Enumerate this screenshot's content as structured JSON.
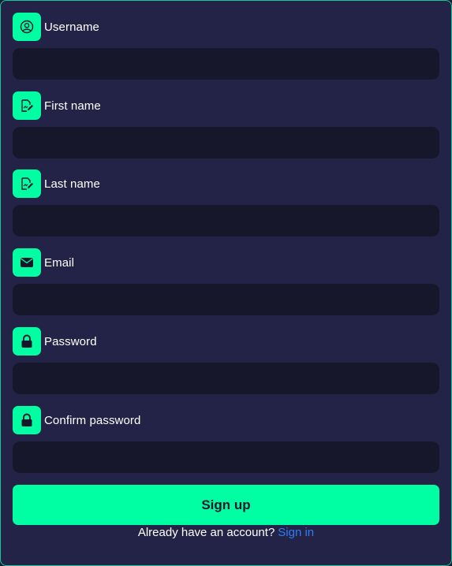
{
  "form": {
    "fields": [
      {
        "label": "Username",
        "icon": "user-circle-icon",
        "value": "",
        "placeholder": ""
      },
      {
        "label": "First name",
        "icon": "edit-document-icon",
        "value": "",
        "placeholder": ""
      },
      {
        "label": "Last name",
        "icon": "edit-document-icon",
        "value": "",
        "placeholder": ""
      },
      {
        "label": "Email",
        "icon": "envelope-icon",
        "value": "",
        "placeholder": ""
      },
      {
        "label": "Password",
        "icon": "lock-icon",
        "value": "",
        "placeholder": ""
      },
      {
        "label": "Confirm password",
        "icon": "lock-icon",
        "value": "",
        "placeholder": ""
      }
    ],
    "submit_label": "Sign up",
    "footer_text": "Already have an account?",
    "footer_link": "Sign in"
  },
  "colors": {
    "accent": "#00ffa3",
    "background": "#232347",
    "input_background": "#17172b",
    "link": "#2f7df5",
    "border": "#14c996"
  }
}
